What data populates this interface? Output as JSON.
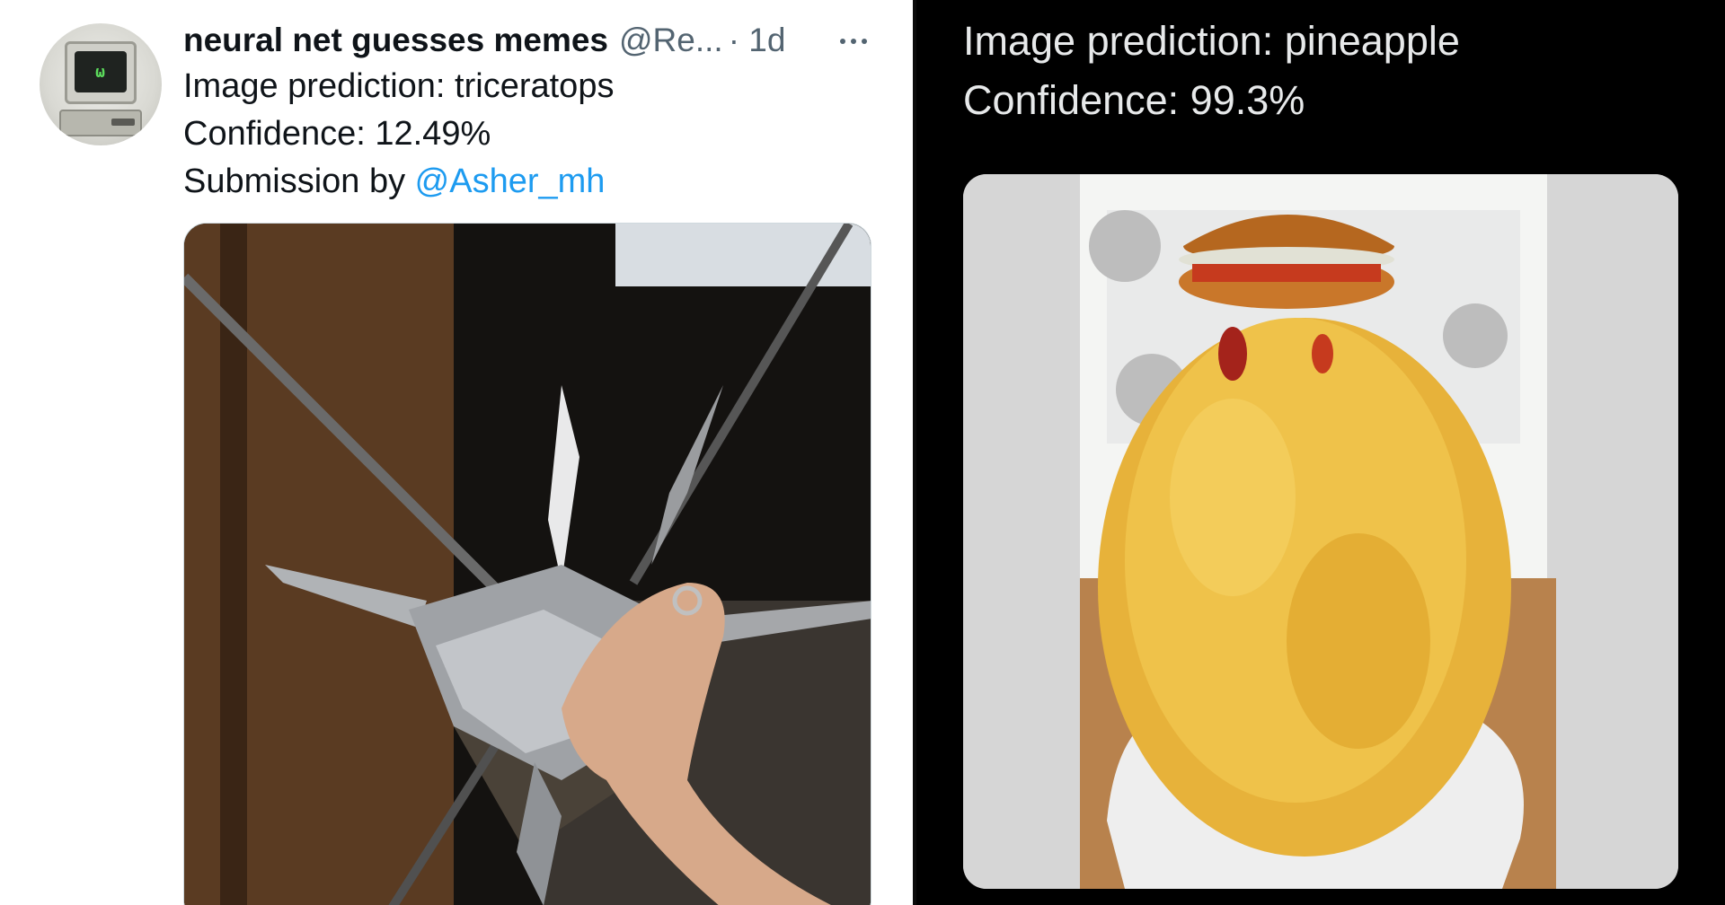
{
  "left_tweet": {
    "display_name": "neural net guesses memes",
    "handle": "@Re...",
    "time": "· 1d",
    "line1": "Image prediction: triceratops",
    "line2": "Confidence: 12.49%",
    "line3_prefix": "Submission by ",
    "mention": "@Asher_mh",
    "avatar_icon": "retro-computer-avatar",
    "avatar_face": "ω",
    "more_icon": "more-options-icon",
    "media_description_icon": "photo"
  },
  "right_tweet": {
    "line1": "Image prediction: pineapple",
    "line2": "Confidence: 99.3%"
  },
  "colors": {
    "link": "#1d9bf0",
    "text_light": "#0f1419",
    "text_secondary": "#536471",
    "text_dark": "#e7e9ea",
    "dark_bg": "#000000"
  }
}
